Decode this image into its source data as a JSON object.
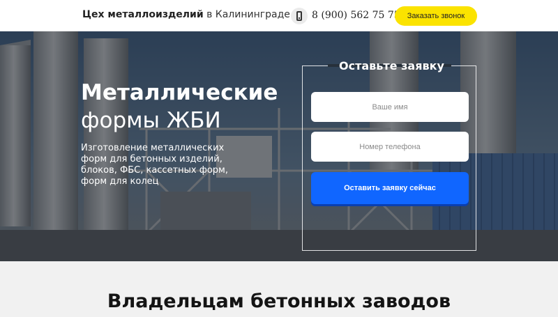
{
  "header": {
    "brand_bold": "Цех металлоизделий",
    "brand_rest": " в Калининграде",
    "phone": "8 (900) 562 75 75",
    "callback_label": "Заказать звонок"
  },
  "hero": {
    "title_line1": "Металлические",
    "title_line2": "формы ЖБИ",
    "description": "Изготовление металлических форм для бетонных изделий, блоков, ФБС, кассетных форм, форм для колец"
  },
  "form": {
    "title": "Оставьте заявку",
    "name_placeholder": "Ваше имя",
    "phone_placeholder": "Номер телефона",
    "submit_label": "Оставить заявку сейчас"
  },
  "section": {
    "title": "Владельцам бетонных заводов"
  },
  "colors": {
    "accent_yellow": "#fbe300",
    "button_blue": "#1066ff",
    "section_bg": "#f1f1f1"
  },
  "icons": [
    "phone-icon"
  ]
}
